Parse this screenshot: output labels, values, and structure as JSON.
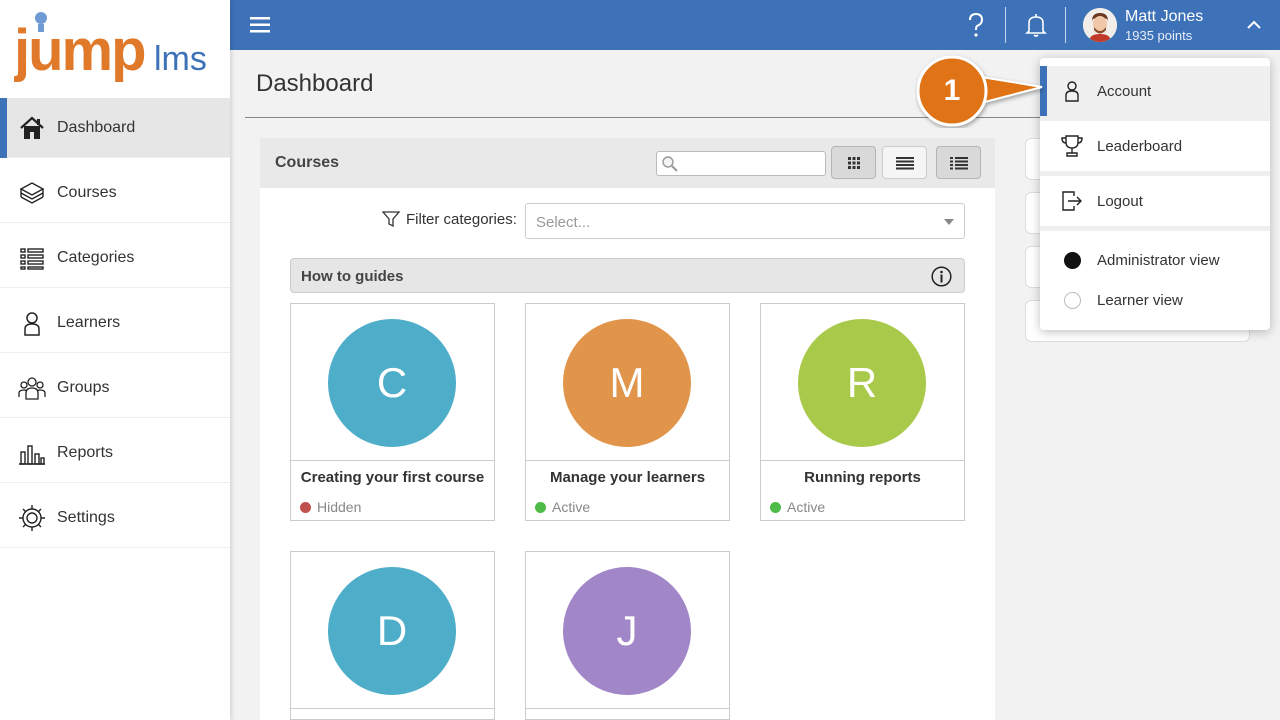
{
  "app": {
    "logo_text_main": "jump",
    "logo_text_sub": "lms",
    "logo_colors": {
      "jump": "#e07a2a",
      "lms": "#3d72b8"
    }
  },
  "sidebar": {
    "items": [
      {
        "label": "Dashboard",
        "icon": "home-icon",
        "active": true
      },
      {
        "label": "Courses",
        "icon": "books-icon",
        "active": false
      },
      {
        "label": "Categories",
        "icon": "list-icon",
        "active": false
      },
      {
        "label": "Learners",
        "icon": "person-icon",
        "active": false
      },
      {
        "label": "Groups",
        "icon": "group-icon",
        "active": false
      },
      {
        "label": "Reports",
        "icon": "bar-chart-icon",
        "active": false
      },
      {
        "label": "Settings",
        "icon": "gear-icon",
        "active": false
      }
    ]
  },
  "topbar": {
    "accent_color": "#3d72b8",
    "user_name": "Matt Jones",
    "user_points": "1935 points"
  },
  "main": {
    "page_title": "Dashboard",
    "courses_panel": {
      "title": "Courses",
      "search_placeholder": "",
      "filter_label": "Filter categories:",
      "filter_placeholder": "Select...",
      "category_title": "How to guides",
      "cards": [
        {
          "letter": "C",
          "title": "Creating your first course",
          "status": "Hidden",
          "color": "#4eadc9",
          "status_color": "#c0504d"
        },
        {
          "letter": "M",
          "title": "Manage your learners",
          "status": "Active",
          "color": "#e0954a",
          "status_color": "#4cbb47"
        },
        {
          "letter": "R",
          "title": "Running reports",
          "status": "Active",
          "color": "#a9c94a",
          "status_color": "#4cbb47"
        },
        {
          "letter": "D",
          "title": "",
          "status": "",
          "color": "#4eadc9",
          "status_color": ""
        },
        {
          "letter": "J",
          "title": "",
          "status": "",
          "color": "#a287c8",
          "status_color": ""
        }
      ]
    }
  },
  "user_menu": {
    "items": [
      {
        "label": "Account",
        "icon": "person-icon"
      },
      {
        "label": "Leaderboard",
        "icon": "trophy-icon"
      },
      {
        "label": "Logout",
        "icon": "logout-icon"
      }
    ],
    "views": [
      {
        "label": "Administrator view",
        "selected": true
      },
      {
        "label": "Learner view",
        "selected": false
      }
    ]
  },
  "callout": {
    "number": "1",
    "color": "#e07314"
  }
}
